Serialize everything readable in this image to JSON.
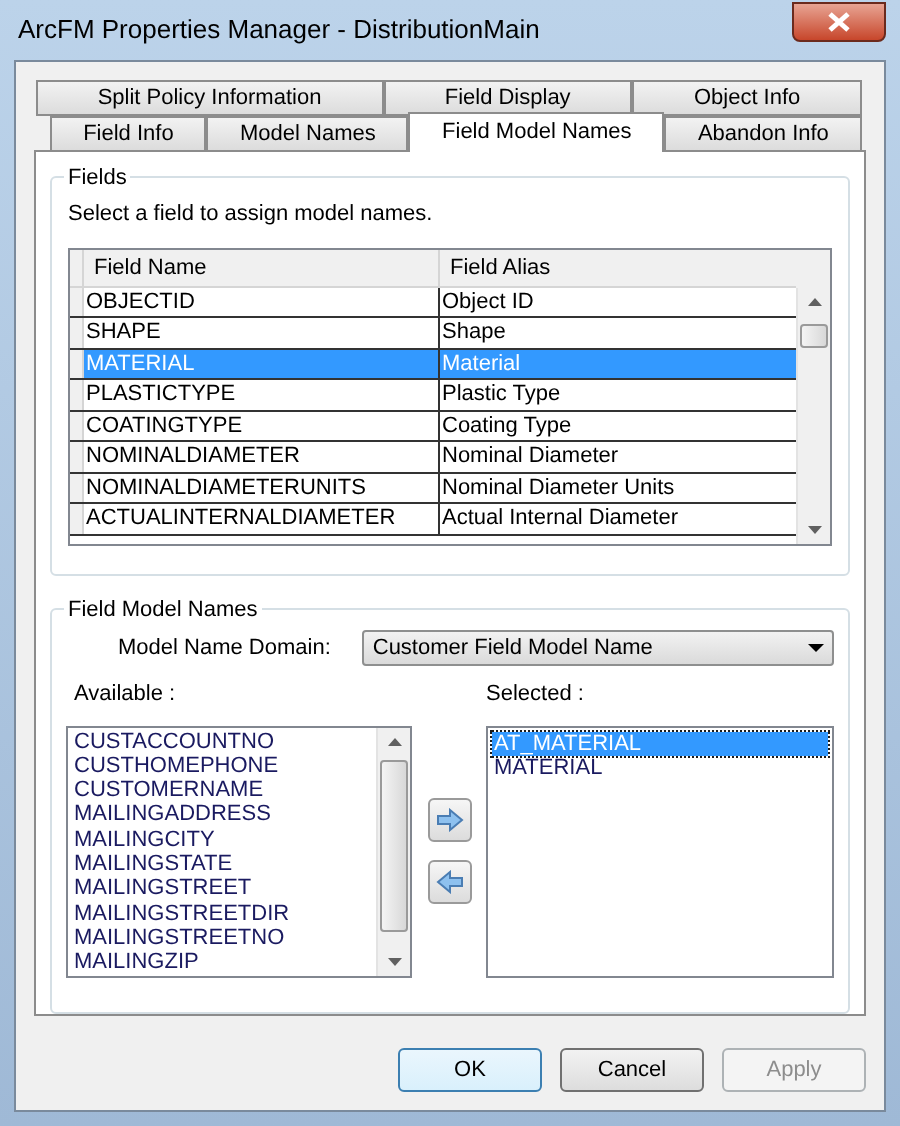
{
  "window": {
    "title": "ArcFM Properties Manager - DistributionMain"
  },
  "tab_rows": [
    [
      {
        "label": "Split Policy Information",
        "selected": false
      },
      {
        "label": "Field Display",
        "selected": false
      },
      {
        "label": "Object Info",
        "selected": false
      }
    ],
    [
      {
        "label": "Field Info",
        "selected": false
      },
      {
        "label": "Model Names",
        "selected": false
      },
      {
        "label": "Field Model Names",
        "selected": true
      },
      {
        "label": "Abandon Info",
        "selected": false
      }
    ]
  ],
  "fields": {
    "title": "Fields",
    "instruction": "Select a field to assign model names.",
    "columns": [
      "Field Name",
      "Field Alias"
    ],
    "rows": [
      {
        "name": "OBJECTID",
        "alias": "Object ID",
        "selected": false
      },
      {
        "name": "SHAPE",
        "alias": "Shape",
        "selected": false
      },
      {
        "name": "MATERIAL",
        "alias": "Material",
        "selected": true
      },
      {
        "name": "PLASTICTYPE",
        "alias": "Plastic Type",
        "selected": false
      },
      {
        "name": "COATINGTYPE",
        "alias": "Coating Type",
        "selected": false
      },
      {
        "name": "NOMINALDIAMETER",
        "alias": "Nominal Diameter",
        "selected": false
      },
      {
        "name": "NOMINALDIAMETERUNITS",
        "alias": "Nominal Diameter Units",
        "selected": false
      },
      {
        "name": "ACTUALINTERNALDIAMETER",
        "alias": "Actual Internal Diameter",
        "selected": false
      }
    ]
  },
  "field_model_names": {
    "title": "Field Model Names",
    "domain_label": "Model Name Domain:",
    "domain_value": "Customer Field Model Name",
    "available_label": "Available :",
    "selected_label": "Selected :",
    "available": [
      {
        "label": "CUSTACCOUNTNO",
        "selected": false
      },
      {
        "label": "CUSTHOMEPHONE",
        "selected": false
      },
      {
        "label": "CUSTOMERNAME",
        "selected": false
      },
      {
        "label": "MAILINGADDRESS",
        "selected": false
      },
      {
        "label": "MAILINGCITY",
        "selected": false
      },
      {
        "label": "MAILINGSTATE",
        "selected": false
      },
      {
        "label": "MAILINGSTREET",
        "selected": false
      },
      {
        "label": "MAILINGSTREETDIR",
        "selected": false
      },
      {
        "label": "MAILINGSTREETNO",
        "selected": false
      },
      {
        "label": "MAILINGZIP",
        "selected": false
      }
    ],
    "selected": [
      {
        "label": "AT_MATERIAL",
        "selected": true
      },
      {
        "label": "MATERIAL",
        "selected": false
      }
    ]
  },
  "buttons": [
    {
      "label": "OK",
      "disabled": false
    },
    {
      "label": "Cancel",
      "disabled": false
    },
    {
      "label": "Apply",
      "disabled": true
    }
  ]
}
